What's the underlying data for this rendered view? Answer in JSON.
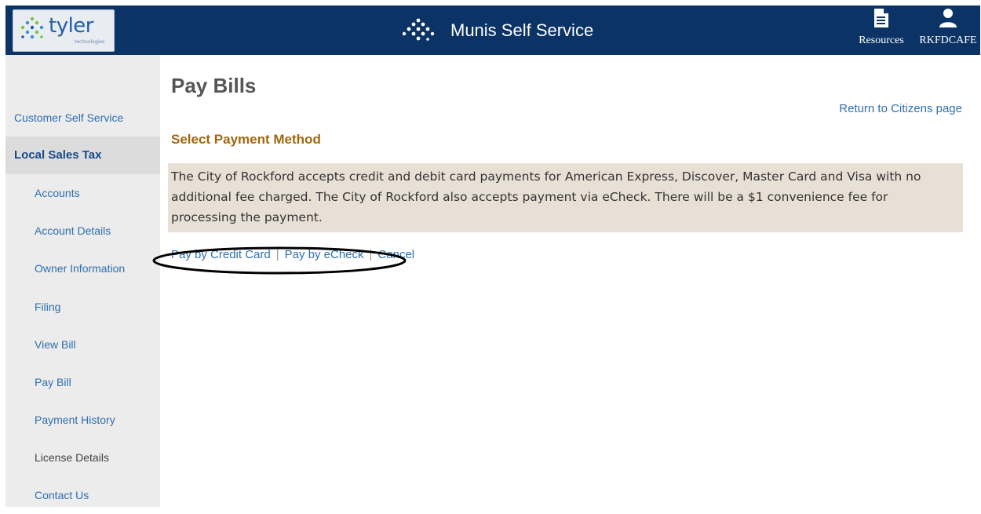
{
  "header": {
    "logo_text": "tyler",
    "logo_subtext": "technologies",
    "app_title": "Munis Self Service",
    "resources_label": "Resources",
    "user_label": "RKFDCAFE"
  },
  "sidebar": {
    "items": [
      {
        "label": "Customer Self Service"
      },
      {
        "label": "Local Sales Tax"
      },
      {
        "label": "Accounts"
      },
      {
        "label": "Account Details"
      },
      {
        "label": "Owner Information"
      },
      {
        "label": "Filing"
      },
      {
        "label": "View Bill"
      },
      {
        "label": "Pay Bill"
      },
      {
        "label": "Payment History"
      },
      {
        "label": "License Details"
      },
      {
        "label": "Contact Us"
      }
    ]
  },
  "main": {
    "title": "Pay Bills",
    "return_link": "Return to Citizens page",
    "section_heading": "Select Payment Method",
    "notice": "The City of Rockford accepts credit and debit card payments for American Express, Discover, Master Card and Visa with no additional fee charged. The City of Rockford also accepts payment via eCheck. There will be a $1 convenience fee for processing the payment.",
    "pay_credit": "Pay by Credit Card",
    "pay_echeck": "Pay by eCheck",
    "cancel": "Cancel",
    "separator": "|"
  },
  "colors": {
    "header_bg": "#0b3366",
    "link": "#2e6fae",
    "heading": "#a0670e",
    "notice_bg": "#e8e0d5",
    "sidebar_bg": "#ececec"
  },
  "icons": [
    "tyler-logo-icon",
    "munis-logo-icon",
    "document-icon",
    "user-icon"
  ]
}
